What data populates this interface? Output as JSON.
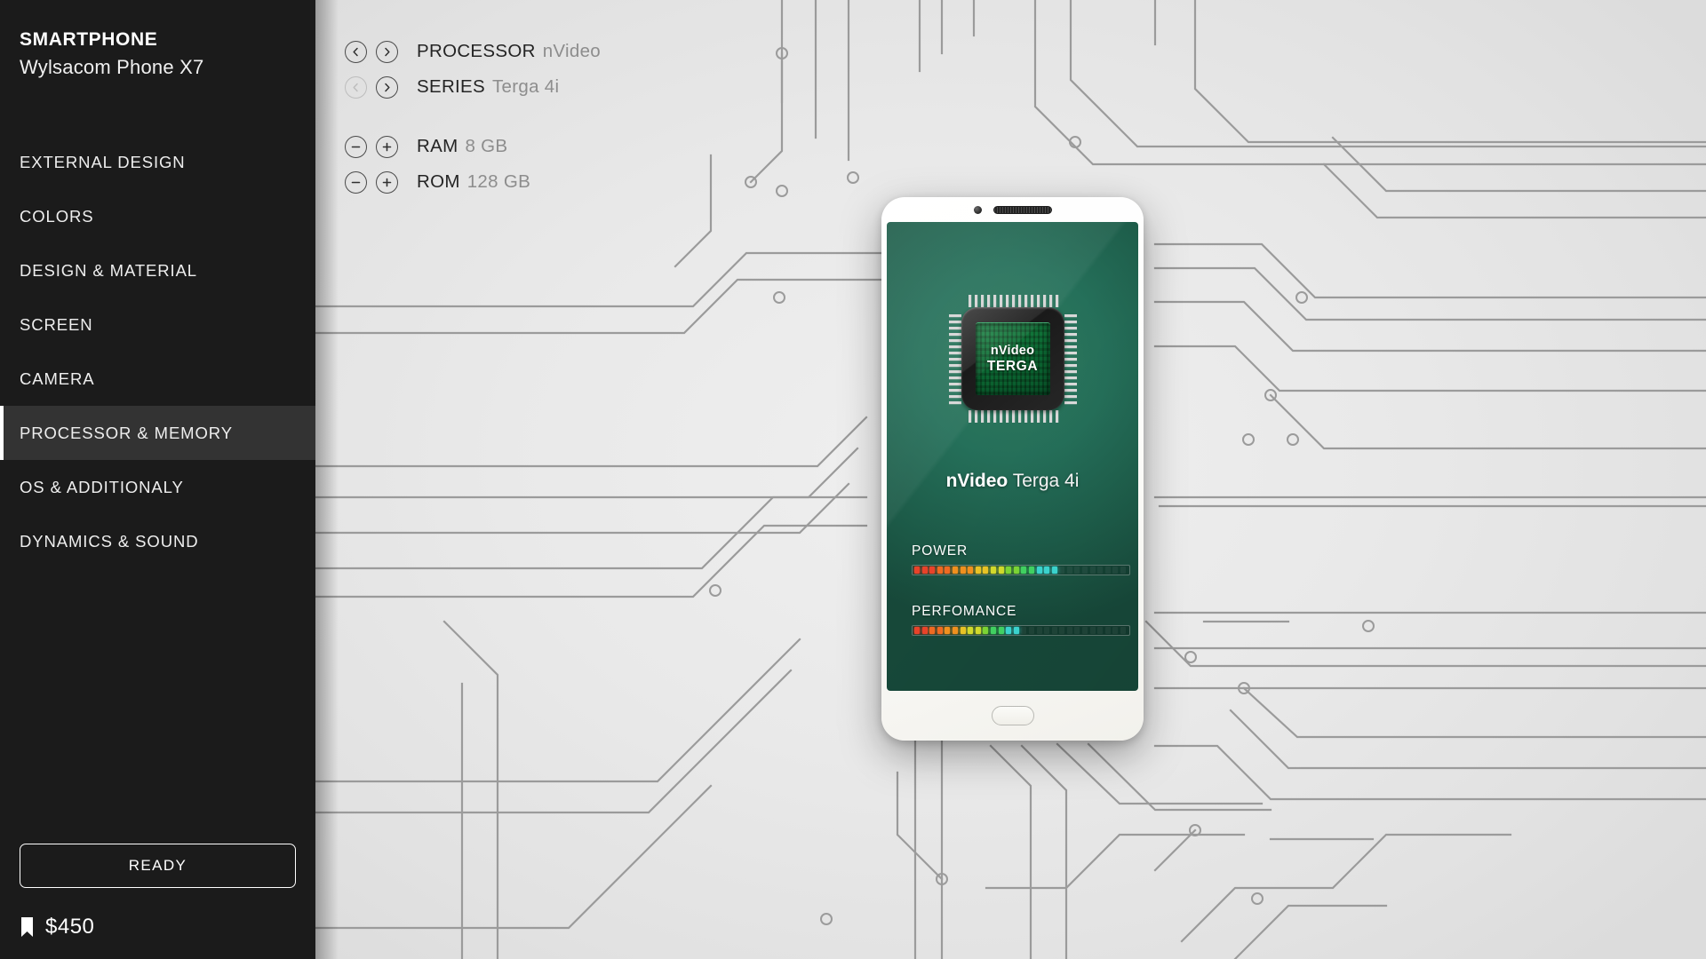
{
  "sidebar": {
    "brand_title": "SMARTPHONE",
    "brand_subtitle": "Wylsacom Phone X7",
    "items": [
      {
        "label": "EXTERNAL DESIGN",
        "active": false
      },
      {
        "label": "COLORS",
        "active": false
      },
      {
        "label": "DESIGN & MATERIAL",
        "active": false
      },
      {
        "label": "SCREEN",
        "active": false
      },
      {
        "label": "CAMERA",
        "active": false
      },
      {
        "label": "PROCESSOR & MEMORY",
        "active": true
      },
      {
        "label": "OS & ADDITIONALY",
        "active": false
      },
      {
        "label": "DYNAMICS & SOUND",
        "active": false
      }
    ],
    "ready_label": "READY",
    "price": "$450",
    "price_icon": "price-tag-icon",
    "bg_color": "#1b1b1b",
    "active_bg_color": "#333333",
    "accent_color": "#ffffff"
  },
  "specs": {
    "selectors": [
      {
        "label": "PROCESSOR",
        "value": "nVideo",
        "prev_icon": "chevron-left-icon",
        "next_icon": "chevron-right-icon",
        "prev_disabled": false,
        "next_disabled": false
      },
      {
        "label": "SERIES",
        "value": "Terga 4i",
        "prev_icon": "chevron-left-icon",
        "next_icon": "chevron-right-icon",
        "prev_disabled": true,
        "next_disabled": false
      }
    ],
    "steppers": [
      {
        "label": "RAM",
        "value": "8 GB",
        "minus_icon": "minus-circle-icon",
        "plus_icon": "plus-circle-icon",
        "minus_disabled": false,
        "plus_disabled": false
      },
      {
        "label": "ROM",
        "value": "128 GB",
        "minus_icon": "minus-circle-icon",
        "plus_icon": "plus-circle-icon",
        "minus_disabled": false,
        "plus_disabled": false
      }
    ]
  },
  "phone": {
    "camera_icon": "front-camera-icon",
    "speaker_icon": "earpiece-speaker-icon",
    "home_button_icon": "home-button-icon",
    "chip": {
      "line1": "nVideo",
      "line2": "TERGA"
    },
    "caption_bold": "nVideo",
    "caption_regular": "Terga 4i",
    "meters": [
      {
        "label": "POWER",
        "filled": 19,
        "total": 28
      },
      {
        "label": "PERFOMANCE",
        "filled": 14,
        "total": 28
      }
    ]
  },
  "colors": {
    "background": "#e9e9e9",
    "trace": "#9a9a9a",
    "screen_green": "#256f58",
    "sidebar": "#1b1b1b"
  }
}
